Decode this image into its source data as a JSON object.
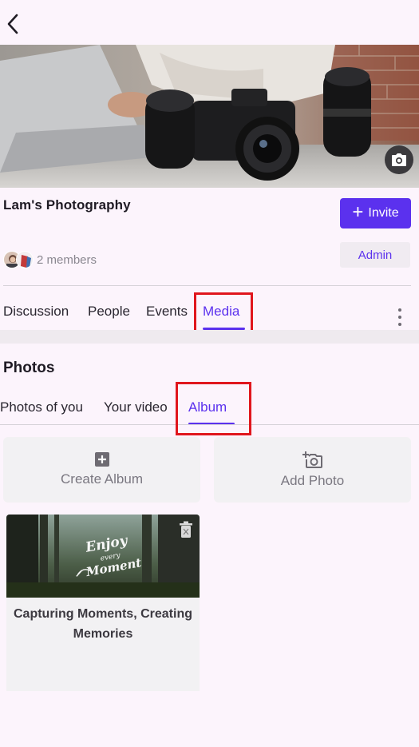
{
  "header": {
    "back_icon": "back-arrow-icon"
  },
  "group": {
    "name": "Lam's Photography",
    "invite_label": "Invite",
    "members_text": "2 members",
    "role_badge": "Admin"
  },
  "tabs": [
    {
      "label": "Discussion",
      "active": false
    },
    {
      "label": "People",
      "active": false
    },
    {
      "label": "Events",
      "active": false
    },
    {
      "label": "Media",
      "active": true
    }
  ],
  "media": {
    "section_title": "Photos",
    "subtabs": [
      {
        "label": "Photos of you",
        "active": false
      },
      {
        "label": "Your video",
        "active": false
      },
      {
        "label": "Album",
        "active": true
      }
    ],
    "actions": {
      "create_album": "Create Album",
      "add_photo": "Add Photo"
    },
    "albums": [
      {
        "title": "Capturing Moments, Creating Memories",
        "thumb_text": [
          "Enjoy",
          "every",
          "Moment"
        ]
      }
    ]
  },
  "colors": {
    "accent": "#5b31ee",
    "background": "#fcf4fc",
    "highlight": "#e0161d"
  }
}
